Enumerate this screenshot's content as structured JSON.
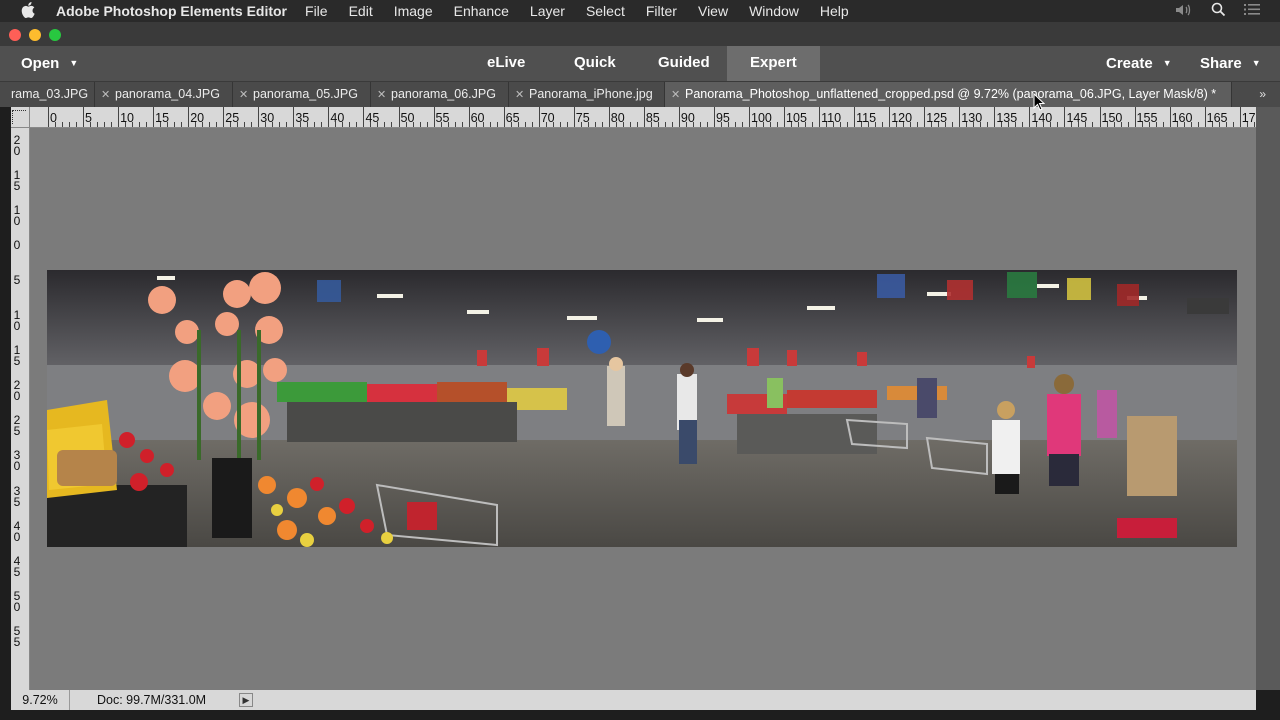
{
  "menubar": {
    "app_name": "Adobe Photoshop Elements Editor",
    "menus": [
      "File",
      "Edit",
      "Image",
      "Enhance",
      "Layer",
      "Select",
      "Filter",
      "View",
      "Window",
      "Help"
    ]
  },
  "modebar": {
    "open_label": "Open",
    "elive_label": "eLive",
    "quick_label": "Quick",
    "guided_label": "Guided",
    "expert_label": "Expert",
    "create_label": "Create",
    "share_label": "Share"
  },
  "tabs": [
    {
      "label": "rama_03.JPG"
    },
    {
      "label": "panorama_04.JPG"
    },
    {
      "label": "panorama_05.JPG"
    },
    {
      "label": "panorama_06.JPG"
    },
    {
      "label": "Panorama_iPhone.jpg"
    },
    {
      "label": "Panorama_Photoshop_unflattened_cropped.psd @ 9.72% (panorama_06.JPG, Layer Mask/8) *"
    }
  ],
  "tabs_more": "»",
  "ruler": {
    "h_ticks": [
      "0",
      "5",
      "10",
      "15",
      "20",
      "25",
      "30",
      "35",
      "40",
      "45",
      "50",
      "55",
      "60",
      "65",
      "70",
      "75",
      "80",
      "85",
      "90",
      "95",
      "100",
      "105",
      "110",
      "115",
      "120",
      "125",
      "130",
      "135",
      "140",
      "145",
      "150",
      "155",
      "160",
      "165",
      "17"
    ],
    "v_ticks": [
      "2 0",
      "1 5",
      "1 0",
      "0",
      "5",
      "1 0",
      "1 5",
      "2 0",
      "2 5",
      "3 0",
      "3 5",
      "4 0",
      "4 5",
      "5 0",
      "5 5"
    ]
  },
  "status": {
    "zoom": "9.72%",
    "doc": "Doc: 99.7M/331.0M",
    "arrow": "▶"
  },
  "colors": {
    "modebar": "#505050",
    "tabs": "#4a4a4a",
    "canvas": "#7b7b7b",
    "ruler": "#d8d8d8"
  }
}
